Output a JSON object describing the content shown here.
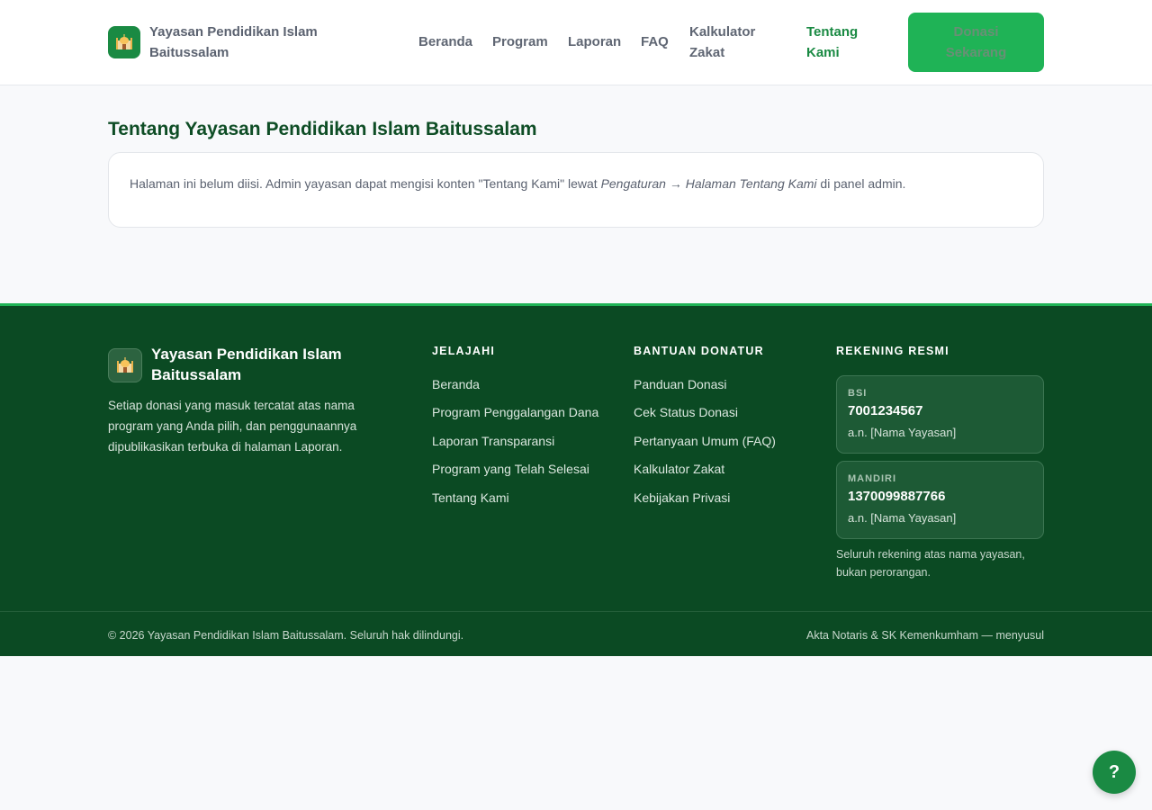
{
  "header": {
    "brand_name": "Yayasan Pendidikan Islam Baitussalam",
    "logo_icon": "mosque-icon",
    "nav": [
      {
        "label": "Beranda",
        "active": false
      },
      {
        "label": "Program",
        "active": false
      },
      {
        "label": "Laporan",
        "active": false
      },
      {
        "label": "FAQ",
        "active": false
      },
      {
        "label": "Kalkulator Zakat",
        "active": false
      },
      {
        "label": "Tentang Kami",
        "active": true
      }
    ],
    "donate_label": "Donasi Sekarang"
  },
  "main": {
    "title": "Tentang Yayasan Pendidikan Islam Baitussalam",
    "card": {
      "text_before": "Halaman ini belum diisi. Admin yayasan dapat mengisi konten \"Tentang Kami\" lewat ",
      "em1": "Pengaturan",
      "arrow": " → ",
      "em2": "Halaman Tentang Kami",
      "text_after": " di panel admin."
    }
  },
  "footer": {
    "brand_name": "Yayasan Pendidikan Islam Baitussalam",
    "description": "Setiap donasi yang masuk tercatat atas nama program yang Anda pilih, dan penggunaannya dipublikasikan terbuka di halaman Laporan.",
    "columns": [
      {
        "title": "JELAJAHI",
        "links": [
          "Beranda",
          "Program Penggalangan Dana",
          "Laporan Transparansi",
          "Program yang Telah Selesai",
          "Tentang Kami"
        ]
      },
      {
        "title": "BANTUAN DONATUR",
        "links": [
          "Panduan Donasi",
          "Cek Status Donasi",
          "Pertanyaan Umum (FAQ)",
          "Kalkulator Zakat",
          "Kebijakan Privasi"
        ]
      }
    ],
    "accounts_title": "REKENING RESMI",
    "accounts": [
      {
        "bank": "BSI",
        "number": "7001234567",
        "holder": "a.n. [Nama Yayasan]"
      },
      {
        "bank": "MANDIRI",
        "number": "1370099887766",
        "holder": "a.n. [Nama Yayasan]"
      }
    ],
    "accounts_note": "Seluruh rekening atas nama yayasan, bukan perorangan.",
    "copyright": "© 2026 Yayasan Pendidikan Islam Baitussalam. Seluruh hak dilindungi.",
    "legal": "Akta Notaris & SK Kemenkumham — menyusul"
  },
  "help_button": {
    "label": "?"
  },
  "colors": {
    "brand_green": "#1a8a43",
    "cta_green": "#1fb356",
    "footer_bg": "#0b4a23",
    "title_green": "#0e4d25"
  }
}
